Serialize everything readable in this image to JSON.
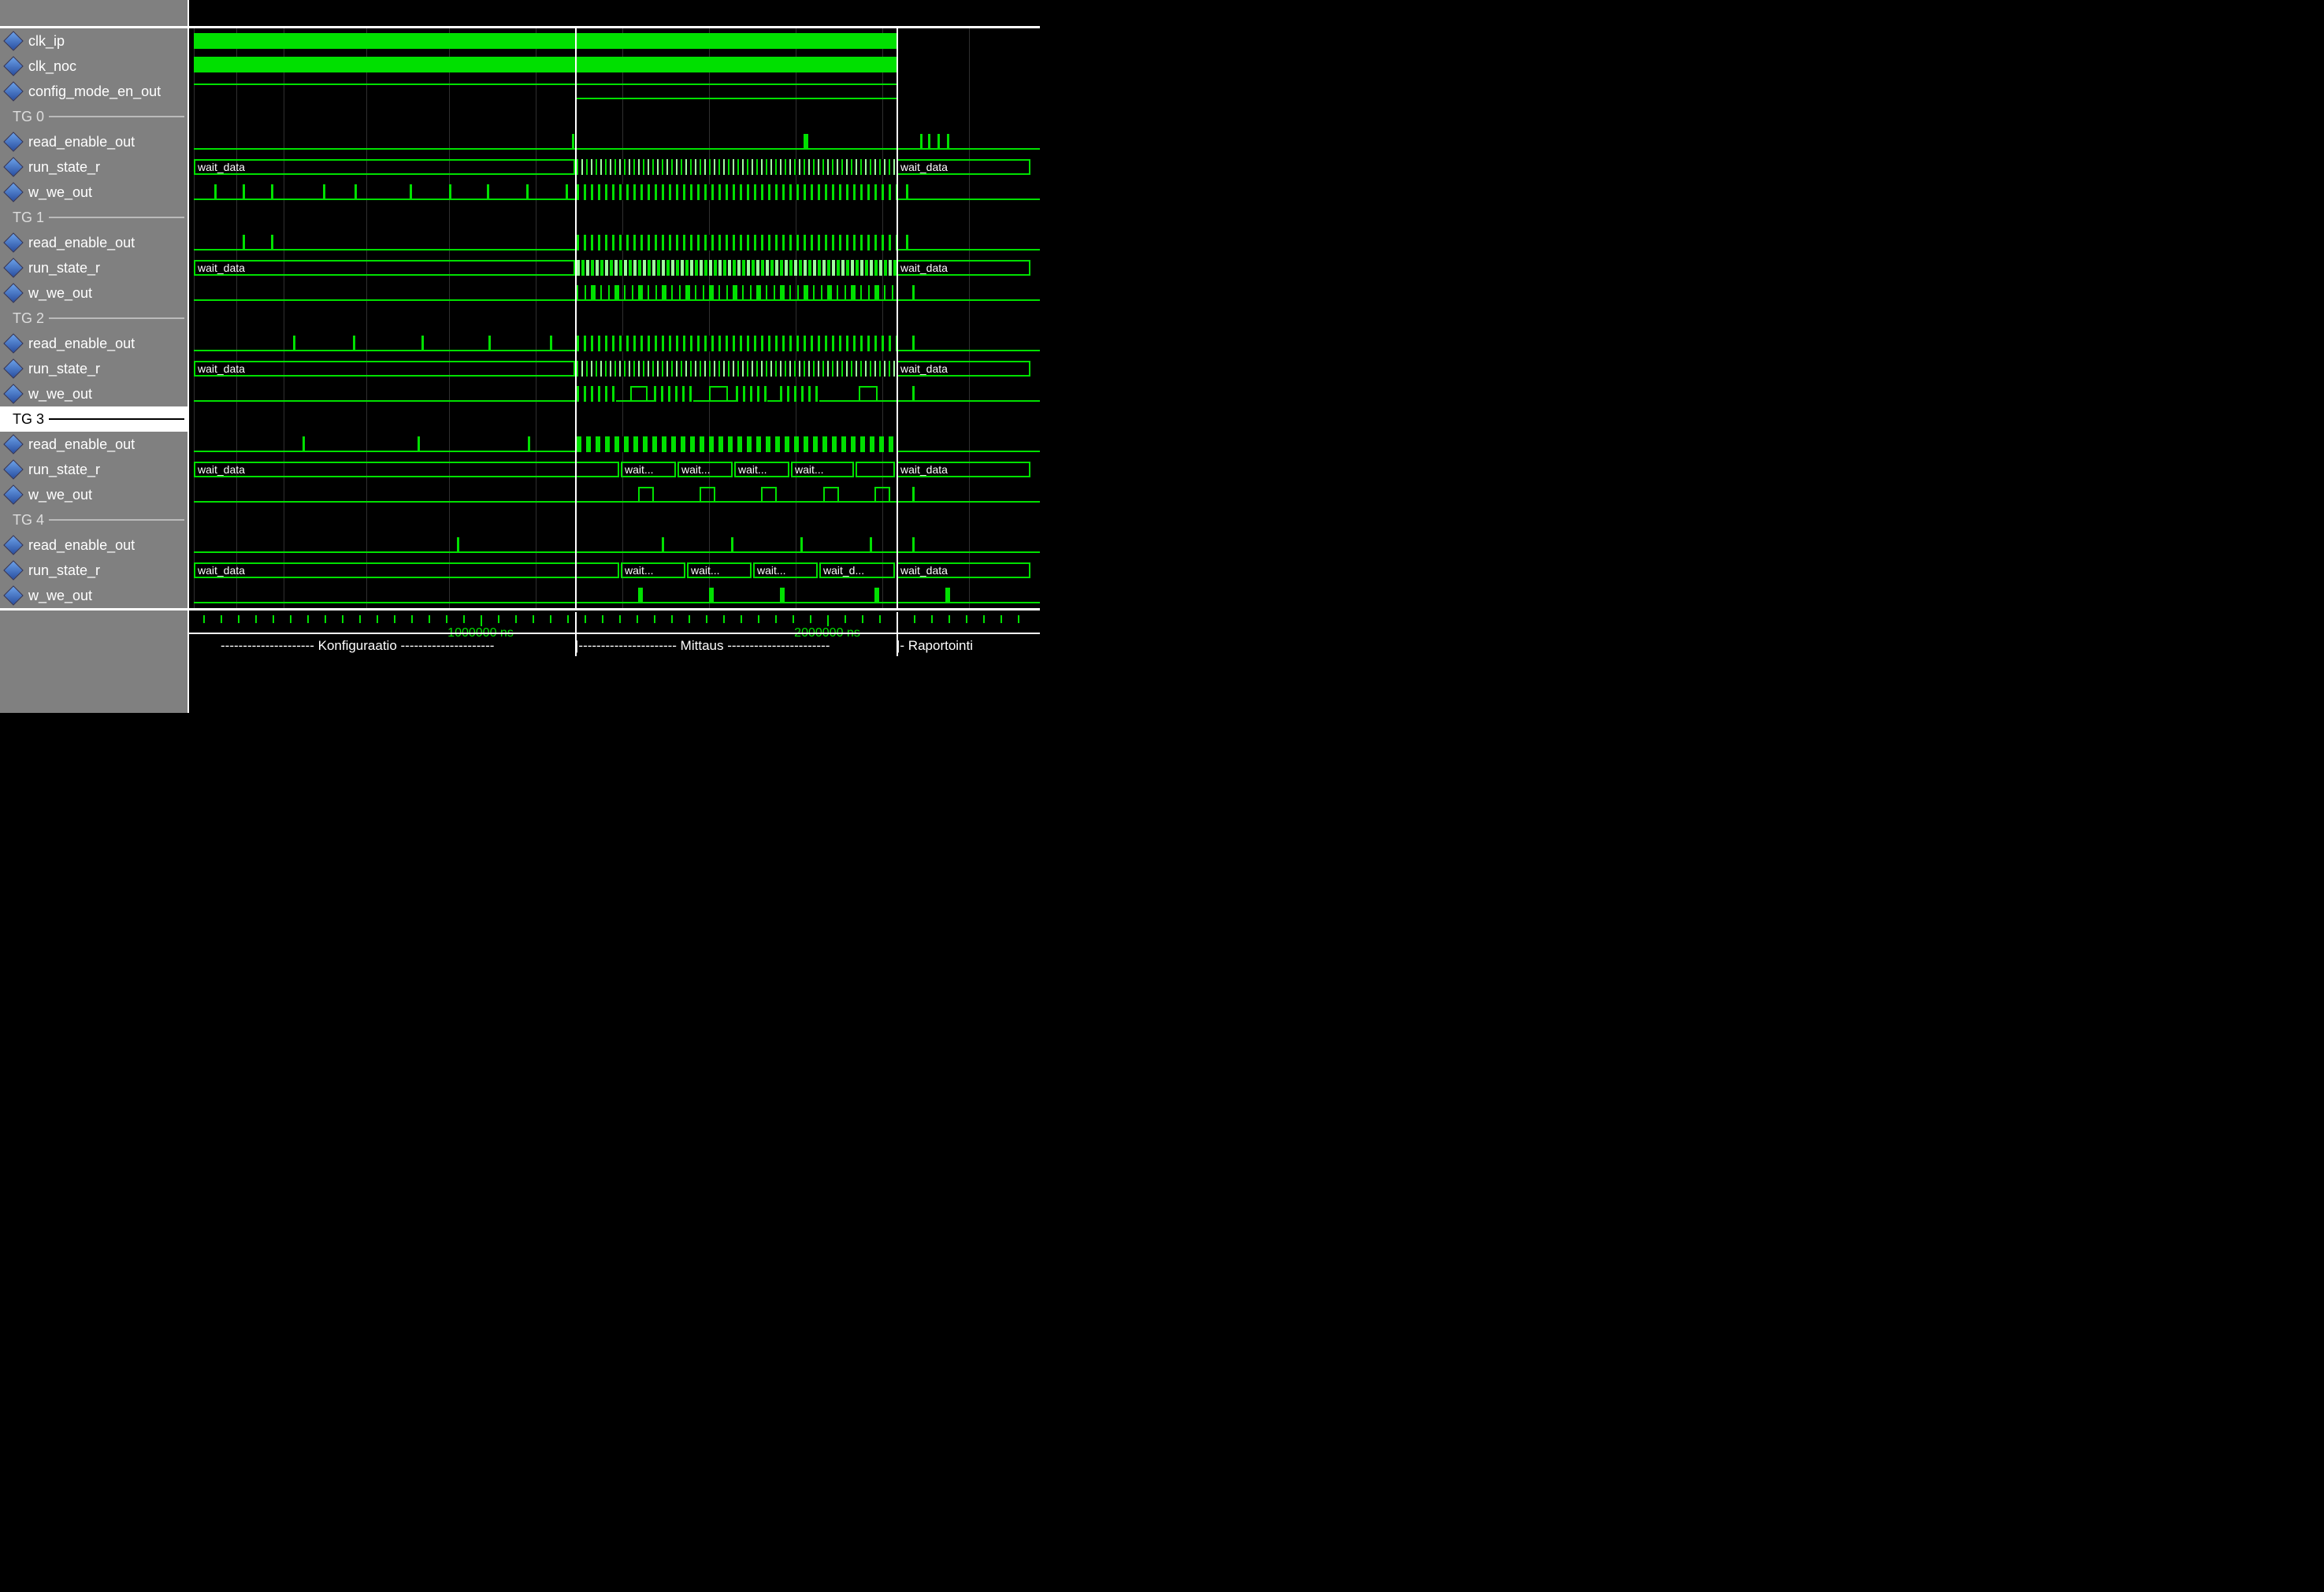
{
  "signals": {
    "clk_ip": "clk_ip",
    "clk_noc": "clk_noc",
    "config_mode_en_out": "config_mode_en_out",
    "read_enable_out": "read_enable_out",
    "run_state_r": "run_state_r",
    "w_we_out": "w_we_out"
  },
  "groups": {
    "tg0": "TG 0",
    "tg1": "TG 1",
    "tg2": "TG 2",
    "tg3": "TG 3",
    "tg4": "TG 4"
  },
  "bus_values": {
    "wait_data": "wait_data",
    "wait_short": "wait...",
    "wait_d": "wait_d..."
  },
  "timeline": {
    "tick_1000000": "1000000 ns",
    "tick_2000000": "2000000 ns"
  },
  "phases": {
    "konfig": "--------------------- Konfiguraatio ---------------------",
    "mittaus": "|---------------------- Mittaus -----------------------",
    "raportointi": "|- Raportointi"
  },
  "colors": {
    "signal_green": "#00e000",
    "background": "#000000",
    "panel_gray": "#808080",
    "divider_white": "#ffffff"
  },
  "cursors": {
    "cursor_a_ns": 1400000,
    "cursor_b_ns": 2170000
  }
}
